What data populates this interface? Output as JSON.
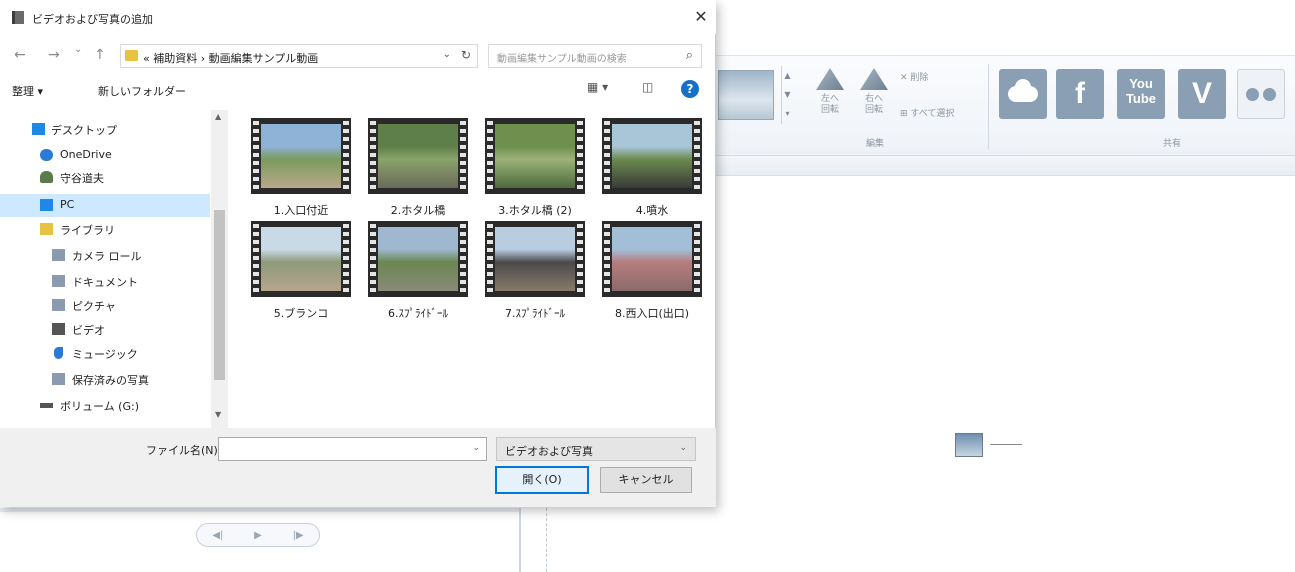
{
  "dialog": {
    "title": "ビデオおよび写真の追加",
    "close_glyph": "✕"
  },
  "nav": {
    "back_glyph": "←",
    "forward_glyph": "→",
    "dropdown_glyph": "⌄",
    "up_glyph": "↑",
    "address": "« 補助資料 › 動画編集サンプル動画",
    "address_dropdown_glyph": "⌄",
    "refresh_glyph": "↻",
    "search_placeholder": "動画編集サンプル動画の検索",
    "search_glyph": "⌕"
  },
  "toolbar": {
    "organize": "整理 ▾",
    "new_folder": "新しいフォルダー",
    "view_glyph": "▦ ▾",
    "pane_glyph": "◫",
    "help_glyph": "?"
  },
  "sidebar": {
    "items": [
      {
        "label": "デスクトップ",
        "icon": "desktop-icon",
        "color": "#1e88e5"
      },
      {
        "label": "OneDrive",
        "icon": "onedrive-icon",
        "color": "#2b7bd6"
      },
      {
        "label": "守谷道夫",
        "icon": "user-icon",
        "color": "#5b7b4a"
      },
      {
        "label": "PC",
        "icon": "pc-icon",
        "color": "#1e88e5"
      },
      {
        "label": "ライブラリ",
        "icon": "library-icon",
        "color": "#e8c341"
      },
      {
        "label": "カメラ ロール",
        "icon": "camera-roll-icon",
        "color": "#8a9bb0"
      },
      {
        "label": "ドキュメント",
        "icon": "documents-icon",
        "color": "#8a9bb0"
      },
      {
        "label": "ピクチャ",
        "icon": "pictures-icon",
        "color": "#8a9bb0"
      },
      {
        "label": "ビデオ",
        "icon": "videos-icon",
        "color": "#555555"
      },
      {
        "label": "ミュージック",
        "icon": "music-icon",
        "color": "#2b7bd6"
      },
      {
        "label": "保存済みの写真",
        "icon": "saved-pictures-icon",
        "color": "#8a9bb0"
      },
      {
        "label": "ボリューム (G:)",
        "icon": "drive-icon",
        "color": "#555555"
      }
    ],
    "selected_index": 3,
    "scroll_up_glyph": "▲",
    "scroll_down_glyph": "▼"
  },
  "files": [
    {
      "label": "1.入口付近",
      "colors": [
        "#8fb3d6",
        "#7a9a5e",
        "#b9a98a"
      ]
    },
    {
      "label": "2.ホタル橋",
      "colors": [
        "#5f7f4a",
        "#8aa36b",
        "#6a6a5a"
      ]
    },
    {
      "label": "3.ホタル橋 (2)",
      "colors": [
        "#6e8f4e",
        "#9cb27a",
        "#4e6a3a"
      ]
    },
    {
      "label": "4.噴水",
      "colors": [
        "#a9c6d9",
        "#6b8a4f",
        "#3a3a3a"
      ]
    },
    {
      "label": "5.ブランコ",
      "colors": [
        "#c9d9e6",
        "#8e9a7a",
        "#b7a58e"
      ]
    },
    {
      "label": "6.ｽﾌﾟﾗｲﾄﾞｰﾙ",
      "colors": [
        "#9fb7cf",
        "#6b8650",
        "#8a8a7a"
      ]
    },
    {
      "label": "7.ｽﾌﾟﾗｲﾄﾞｰﾙ",
      "colors": [
        "#b9cde0",
        "#4a4a4a",
        "#8a7a6a"
      ]
    },
    {
      "label": "8.西入口(出口)",
      "colors": [
        "#a3bfd8",
        "#b77d7d",
        "#8b6a6a"
      ]
    }
  ],
  "footer": {
    "filename_label": "ファイル名(N):",
    "filename_value": "",
    "filename_dd_glyph": "⌄",
    "filter_value": "ビデオおよび写真",
    "filter_dd_glyph": "⌄",
    "open_button": "開く(O)",
    "cancel_button": "キャンセル"
  },
  "background_app": {
    "ribbon": {
      "scroll_up_glyph": "▲",
      "scroll_down_glyph": "▼",
      "more_glyph": "▾",
      "rotate_left": "左へ\n回転",
      "rotate_right": "右へ\n回転",
      "delete": "✕ 削除",
      "select_all": "⊞ すべて選択",
      "edit_group": "編集",
      "share_group": "共有"
    },
    "share_services": [
      {
        "name": "onedrive-share",
        "glyph": ""
      },
      {
        "name": "facebook-share",
        "glyph": "f"
      },
      {
        "name": "youtube-share",
        "glyph": "You\nTube"
      },
      {
        "name": "vimeo-share",
        "glyph": "V"
      },
      {
        "name": "flickr-share",
        "glyph": ""
      }
    ],
    "playback": {
      "prev_glyph": "◀|",
      "play_glyph": "▶",
      "next_glyph": "|▶"
    }
  }
}
